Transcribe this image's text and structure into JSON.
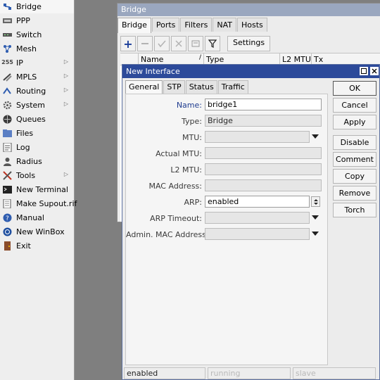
{
  "sidebar": {
    "items": [
      {
        "label": "Bridge",
        "icon": "bridge-icon",
        "active": true,
        "submenu": false
      },
      {
        "label": "PPP",
        "icon": "ppp-icon",
        "submenu": false
      },
      {
        "label": "Switch",
        "icon": "switch-icon",
        "submenu": false
      },
      {
        "label": "Mesh",
        "icon": "mesh-icon",
        "submenu": false
      },
      {
        "label": "IP",
        "icon": "ip-icon",
        "submenu": true
      },
      {
        "label": "MPLS",
        "icon": "mpls-icon",
        "submenu": true
      },
      {
        "label": "Routing",
        "icon": "routing-icon",
        "submenu": true
      },
      {
        "label": "System",
        "icon": "gear-icon",
        "submenu": true
      },
      {
        "label": "Queues",
        "icon": "queues-icon",
        "submenu": false
      },
      {
        "label": "Files",
        "icon": "folder-icon",
        "submenu": false
      },
      {
        "label": "Log",
        "icon": "log-icon",
        "submenu": false
      },
      {
        "label": "Radius",
        "icon": "radius-icon",
        "submenu": false
      },
      {
        "label": "Tools",
        "icon": "tools-icon",
        "submenu": true
      },
      {
        "label": "New Terminal",
        "icon": "terminal-icon",
        "submenu": false
      },
      {
        "label": "Make Supout.rif",
        "icon": "supout-icon",
        "submenu": false
      },
      {
        "label": "Manual",
        "icon": "help-icon",
        "submenu": false
      },
      {
        "label": "New WinBox",
        "icon": "winbox-icon",
        "submenu": false
      },
      {
        "label": "Exit",
        "icon": "exit-icon",
        "submenu": false
      }
    ]
  },
  "bridge_window": {
    "title": "Bridge",
    "tabs": [
      "Bridge",
      "Ports",
      "Filters",
      "NAT",
      "Hosts"
    ],
    "active_tab": "Bridge",
    "toolbar": {
      "settings_label": "Settings",
      "icons": [
        "add-icon",
        "remove-icon",
        "enable-icon",
        "disable-icon",
        "comment-icon",
        "filter-icon"
      ]
    },
    "columns": [
      "Name",
      "Type",
      "L2 MTU",
      "Tx"
    ]
  },
  "dialog": {
    "title": "New Interface",
    "tabs": [
      "General",
      "STP",
      "Status",
      "Traffic"
    ],
    "active_tab": "General",
    "fields": [
      {
        "label": "Name:",
        "value": "bridge1",
        "kind": "text",
        "editable": true
      },
      {
        "label": "Type:",
        "value": "Bridge",
        "kind": "readonly"
      },
      {
        "label": "MTU:",
        "value": "",
        "kind": "dropdown"
      },
      {
        "label": "Actual MTU:",
        "value": "",
        "kind": "readonly"
      },
      {
        "label": "L2 MTU:",
        "value": "",
        "kind": "readonly"
      },
      {
        "label": "MAC Address:",
        "value": "",
        "kind": "readonly"
      },
      {
        "label": "ARP:",
        "value": "enabled",
        "kind": "select",
        "editable": true
      },
      {
        "label": "ARP Timeout:",
        "value": "",
        "kind": "dropdown"
      },
      {
        "label": "Admin. MAC Address:",
        "value": "",
        "kind": "dropdown"
      }
    ],
    "buttons": [
      "OK",
      "Cancel",
      "Apply",
      "Disable",
      "Comment",
      "Copy",
      "Remove",
      "Torch"
    ],
    "status": [
      "enabled",
      "running",
      "slave"
    ]
  },
  "colors": {
    "dialog_title": "#2c4a9a",
    "inactive_title": "#9aa7bf",
    "desktop": "#7f7f7f"
  }
}
